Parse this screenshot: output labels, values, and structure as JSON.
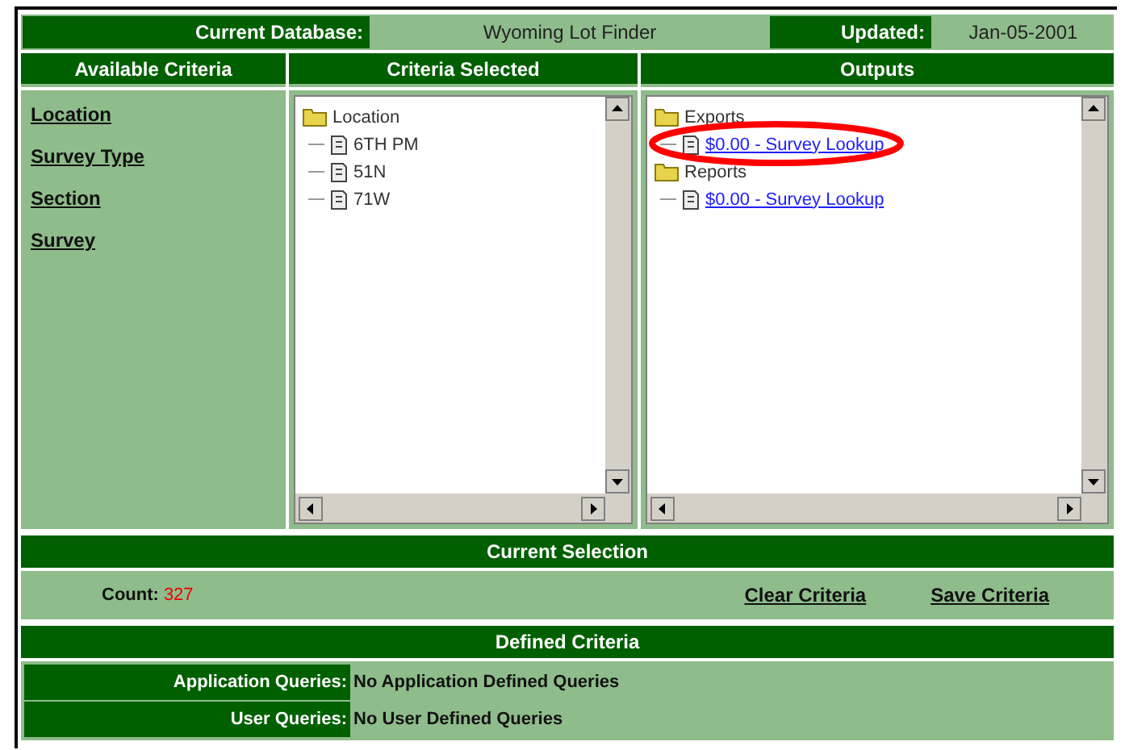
{
  "header": {
    "database_label": "Current Database:",
    "database": "Wyoming Lot Finder",
    "updated_label": "Updated:",
    "updated": "Jan-05-2001"
  },
  "columns": [
    "Available Criteria",
    "Criteria Selected",
    "Outputs"
  ],
  "available_criteria": [
    "Location",
    "Survey Type",
    "Section",
    "Survey"
  ],
  "criteria_selected": [
    {
      "label": "Location",
      "kind": "folder",
      "children": [
        {
          "label": "6TH PM",
          "kind": "document"
        },
        {
          "label": "51N",
          "kind": "document"
        },
        {
          "label": "71W",
          "kind": "document"
        }
      ]
    }
  ],
  "outputs": [
    {
      "label": "Exports",
      "kind": "folder",
      "children": [
        {
          "label": "$0.00 - Survey Lookup",
          "kind": "link",
          "circled": true
        }
      ]
    },
    {
      "label": "Reports",
      "kind": "folder",
      "children": [
        {
          "label": "$0.00 - Survey Lookup",
          "kind": "link",
          "circled": false
        }
      ]
    }
  ],
  "current_selection": {
    "title": "Current Selection",
    "count_label": "Count:",
    "count": "327",
    "actions": [
      "Clear Criteria",
      "Save Criteria"
    ]
  },
  "defined_criteria": {
    "title": "Defined Criteria",
    "rows": [
      {
        "label": "Application Queries:",
        "value": "No Application Defined Queries"
      },
      {
        "label": "User Queries:",
        "value": "No User Defined Queries"
      }
    ]
  }
}
